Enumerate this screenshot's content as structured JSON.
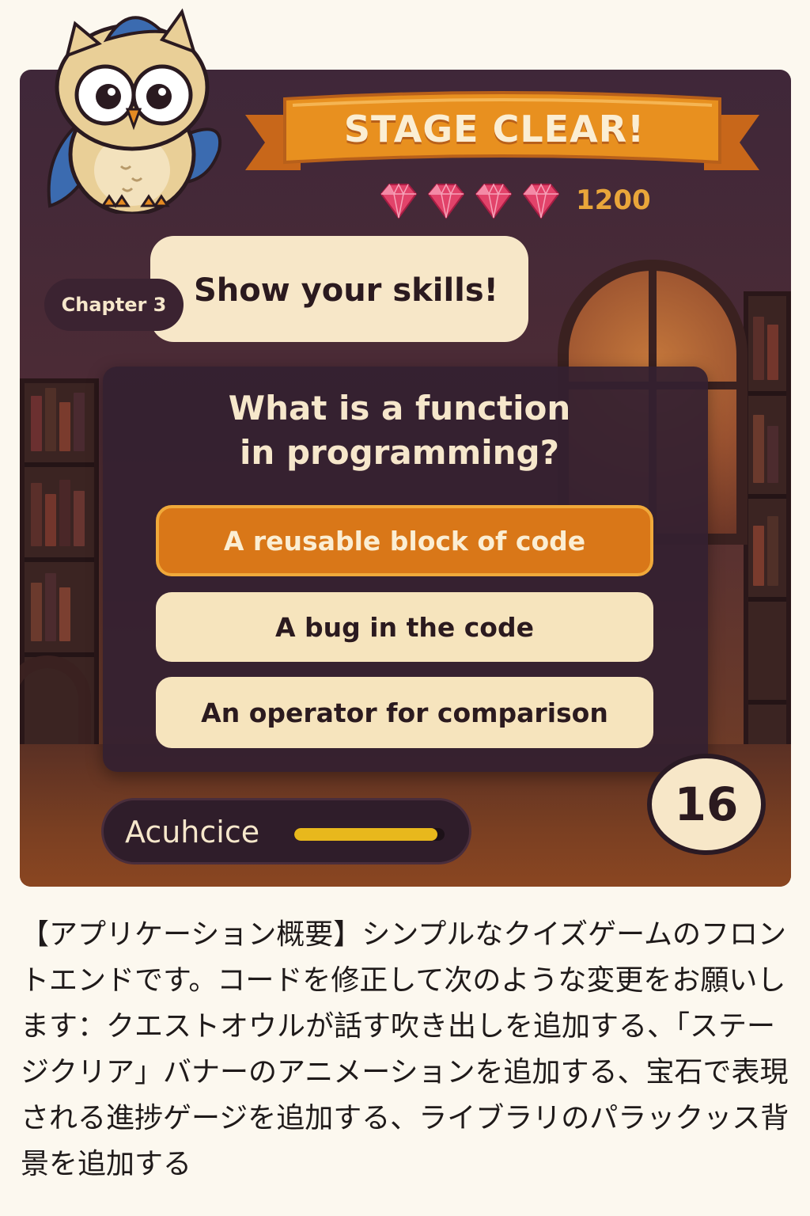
{
  "banner": {
    "title": "STAGE CLEAR!"
  },
  "gems": {
    "count": 4,
    "icon": "gem-icon",
    "color": "#e2436a"
  },
  "score": "1200",
  "chapter": "Chapter 3",
  "speech": "Show your skills!",
  "question": {
    "line1": "What is a function",
    "line2": "in programming?"
  },
  "options": [
    {
      "label": "A reusable block of code",
      "selected": true
    },
    {
      "label": "A bug in the code",
      "selected": false
    },
    {
      "label": "An operator for comparison",
      "selected": false
    }
  ],
  "progress": {
    "label": "Acuhcice",
    "value": 0.95
  },
  "timer": "16",
  "colors": {
    "accent": "#d97718",
    "option_bg": "#f6e4bd",
    "panel": "#342030",
    "progress_fill": "#e8b81c"
  },
  "description": "【アプリケーション概要】シンプルなクイズゲームのフロントエンドです。コードを修正して次のような変更をお願いします：クエストオウルが話す吹き出しを追加する、「ステージクリア」バナーのアニメーションを追加する、宝石で表現される進捗ゲージを追加する、ライブラリのパラックッス背景を追加する"
}
